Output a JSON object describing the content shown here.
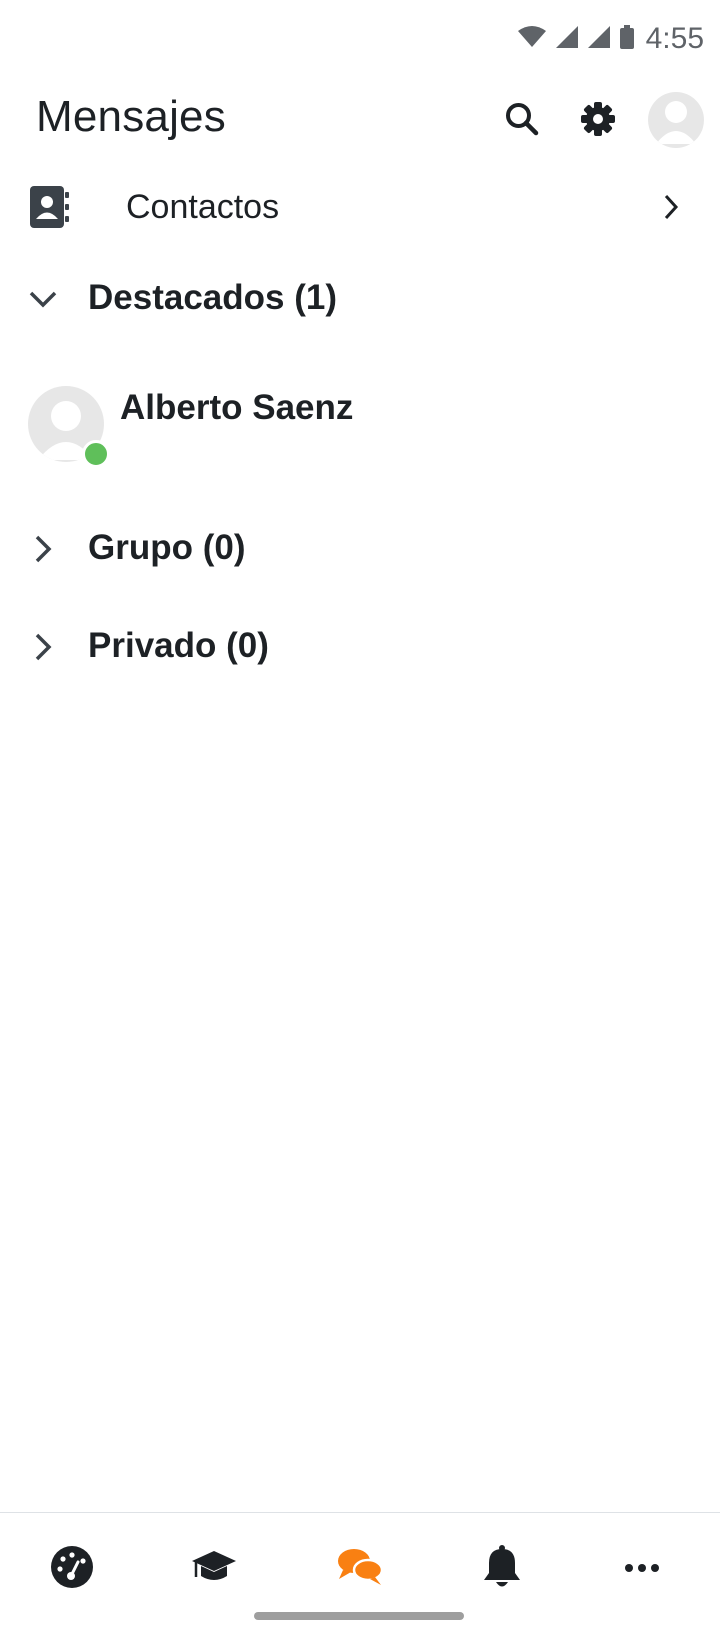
{
  "status_bar": {
    "time": "4:55"
  },
  "header": {
    "title": "Mensajes"
  },
  "contacts": {
    "label": "Contactos"
  },
  "sections": {
    "starred": {
      "label": "Destacados (1)"
    },
    "group": {
      "label": "Grupo (0)"
    },
    "private": {
      "label": "Privado (0)"
    }
  },
  "conversations": [
    {
      "name": "Alberto Saenz",
      "online": true
    }
  ],
  "bottom_nav": {
    "items": [
      {
        "icon": "dashboard-icon"
      },
      {
        "icon": "graduation-cap-icon"
      },
      {
        "icon": "messages-icon",
        "active": true
      },
      {
        "icon": "bell-icon"
      },
      {
        "icon": "more-icon"
      }
    ]
  },
  "colors": {
    "accent": "#f98012",
    "text": "#1d2125",
    "online": "#5fbf5a",
    "status_icons": "#5f6368"
  }
}
